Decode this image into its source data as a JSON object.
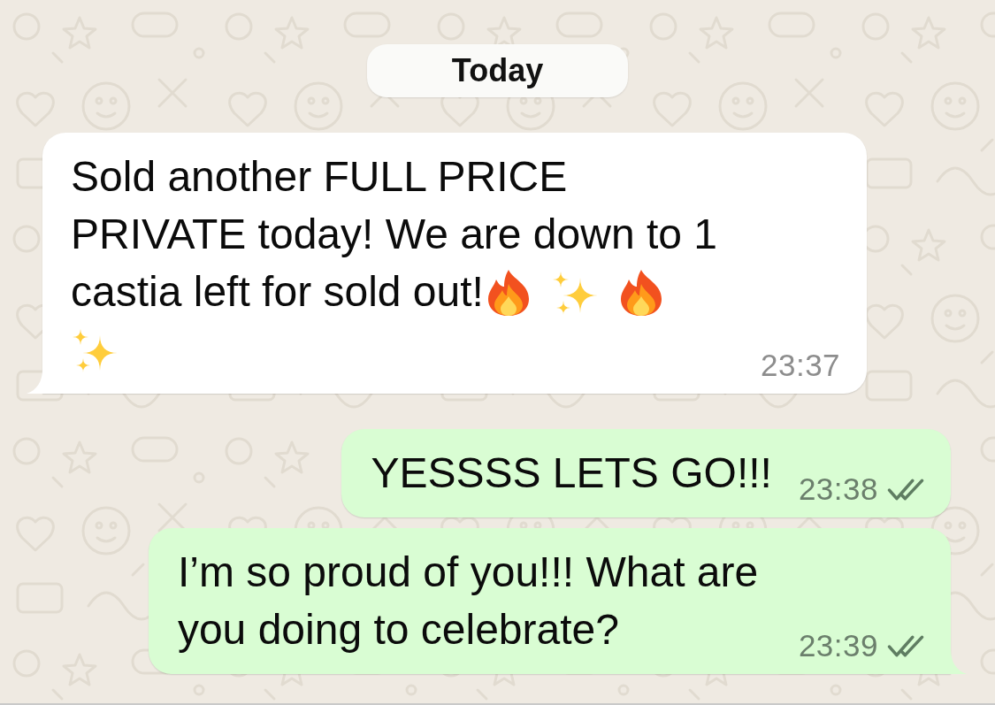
{
  "date_divider": {
    "label": "Today"
  },
  "messages": [
    {
      "kind": "incoming",
      "text": "Sold another FULL PRICE PRIVATE today! We are down to 1 castia left for sold out!",
      "emojis": [
        {
          "kind": "fire"
        },
        {
          "kind": "sparkles"
        },
        {
          "kind": "fire"
        },
        {
          "kind": "sparkles"
        }
      ],
      "time": "23:37",
      "tail": true
    },
    {
      "kind": "outgoing",
      "text": "YESSSS LETS GO!!!",
      "time": "23:38",
      "delivered": true,
      "tail": false
    },
    {
      "kind": "outgoing",
      "text": "I’m so proud of you!!! What are you doing to celebrate?",
      "time": "23:39",
      "delivered": true,
      "tail": true
    }
  ]
}
